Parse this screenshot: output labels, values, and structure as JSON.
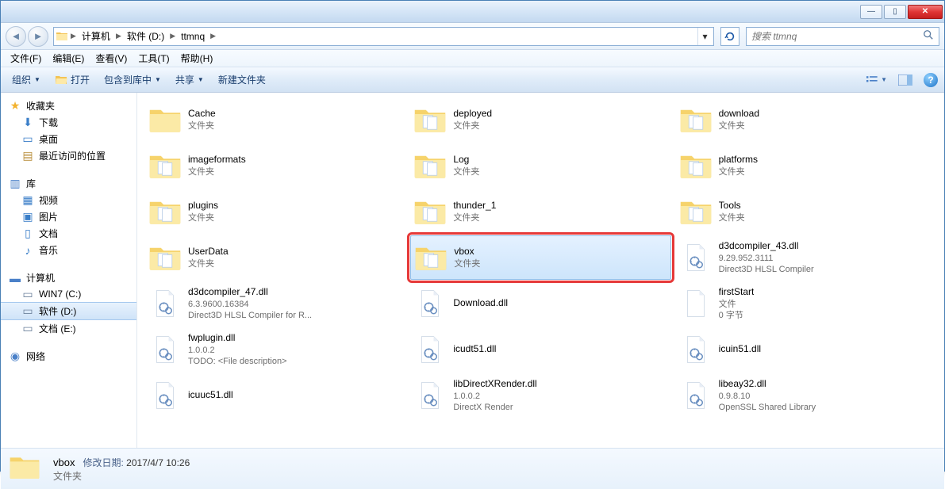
{
  "titlebar": {
    "min": "—",
    "max": "▯",
    "close": "✕"
  },
  "nav": {
    "crumbs": [
      "计算机",
      "软件 (D:)",
      "ttmnq"
    ],
    "refresh": "↻"
  },
  "search": {
    "placeholder": "搜索 ttmnq"
  },
  "menu": [
    "文件(F)",
    "编辑(E)",
    "查看(V)",
    "工具(T)",
    "帮助(H)"
  ],
  "toolbar": {
    "organize": "组织",
    "open": "打开",
    "include": "包含到库中",
    "share": "共享",
    "newfolder": "新建文件夹"
  },
  "sidebar": {
    "favorites": {
      "label": "收藏夹",
      "items": [
        "下载",
        "桌面",
        "最近访问的位置"
      ]
    },
    "library": {
      "label": "库",
      "items": [
        "视频",
        "图片",
        "文档",
        "音乐"
      ]
    },
    "computer": {
      "label": "计算机",
      "items": [
        "WIN7 (C:)",
        "软件 (D:)",
        "文档 (E:)"
      ]
    },
    "network": {
      "label": "网络"
    },
    "selected": "软件 (D:)"
  },
  "files": [
    {
      "name": "Cache",
      "type": "文件夹",
      "icon": "folder"
    },
    {
      "name": "deployed",
      "type": "文件夹",
      "icon": "folder-doc"
    },
    {
      "name": "download",
      "type": "文件夹",
      "icon": "folder-doc"
    },
    {
      "name": "imageformats",
      "type": "文件夹",
      "icon": "folder-doc"
    },
    {
      "name": "Log",
      "type": "文件夹",
      "icon": "folder-doc"
    },
    {
      "name": "platforms",
      "type": "文件夹",
      "icon": "folder-doc"
    },
    {
      "name": "plugins",
      "type": "文件夹",
      "icon": "folder-doc"
    },
    {
      "name": "thunder_1",
      "type": "文件夹",
      "icon": "folder-doc"
    },
    {
      "name": "Tools",
      "type": "文件夹",
      "icon": "folder-doc"
    },
    {
      "name": "UserData",
      "type": "文件夹",
      "icon": "folder-doc"
    },
    {
      "name": "vbox",
      "type": "文件夹",
      "icon": "folder-doc",
      "selected": true,
      "highlight": true
    },
    {
      "name": "d3dcompiler_43.dll",
      "type": "9.29.952.3111",
      "meta": "Direct3D HLSL Compiler",
      "icon": "dll"
    },
    {
      "name": "d3dcompiler_47.dll",
      "type": "6.3.9600.16384",
      "meta": "Direct3D HLSL Compiler for R...",
      "icon": "dll"
    },
    {
      "name": "Download.dll",
      "type": "",
      "icon": "dll"
    },
    {
      "name": "firstStart",
      "type": "文件",
      "meta": "0 字节",
      "icon": "file"
    },
    {
      "name": "fwplugin.dll",
      "type": "1.0.0.2",
      "meta": "TODO: <File description>",
      "icon": "dll"
    },
    {
      "name": "icudt51.dll",
      "type": "",
      "icon": "dll"
    },
    {
      "name": "icuin51.dll",
      "type": "",
      "icon": "dll"
    },
    {
      "name": "icuuc51.dll",
      "type": "",
      "icon": "dll"
    },
    {
      "name": "libDirectXRender.dll",
      "type": "1.0.0.2",
      "meta": "DirectX Render",
      "icon": "dll"
    },
    {
      "name": "libeay32.dll",
      "type": "0.9.8.10",
      "meta": "OpenSSL Shared Library",
      "icon": "dll"
    }
  ],
  "details": {
    "name": "vbox",
    "type": "文件夹",
    "prop_label": "修改日期:",
    "prop_value": "2017/4/7 10:26"
  },
  "icons": {
    "star": "★",
    "download": "⬇",
    "desktop": "🖥",
    "recent": "📑",
    "lib": "📚",
    "video": "🎞",
    "pic": "🖼",
    "doc": "📄",
    "music": "♪",
    "computer": "💻",
    "drive": "💽",
    "net": "🌐",
    "folder": "📁"
  }
}
